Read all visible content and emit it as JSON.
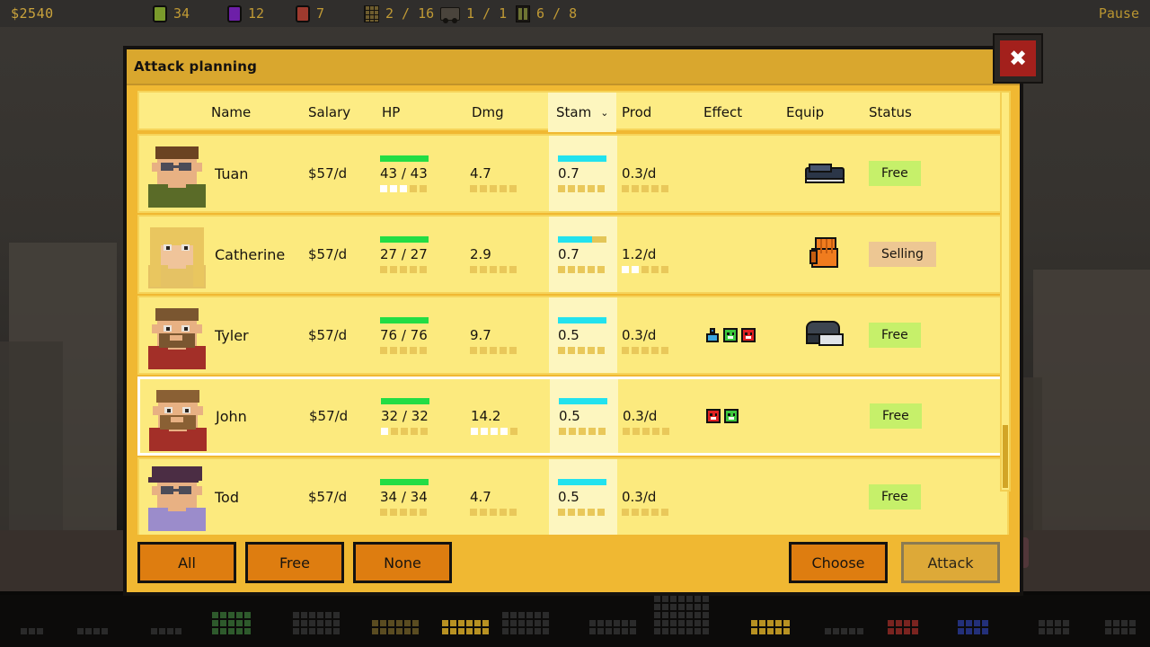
{
  "hud": {
    "money": "$2540",
    "resources": [
      {
        "icon": "green-gem-icon",
        "name": "resource-green",
        "value": "34"
      },
      {
        "icon": "purple-gem-icon",
        "name": "resource-purple",
        "value": "12"
      },
      {
        "icon": "red-gem-icon",
        "name": "resource-red",
        "value": "7"
      }
    ],
    "counters": [
      {
        "icon": "building-icon",
        "name": "buildings-counter",
        "value": "2 / 16"
      },
      {
        "icon": "truck-icon",
        "name": "vehicles-counter",
        "value": "1 / 1"
      },
      {
        "icon": "door-icon",
        "name": "doors-counter",
        "value": "6 / 8"
      }
    ],
    "pause_label": "Pause"
  },
  "dialog": {
    "title": "Attack planning",
    "close_label": "✖",
    "columns": [
      {
        "key": "name",
        "label": "Name"
      },
      {
        "key": "salary",
        "label": "Salary"
      },
      {
        "key": "hp",
        "label": "HP"
      },
      {
        "key": "dmg",
        "label": "Dmg"
      },
      {
        "key": "stam",
        "label": "Stam",
        "sorted": true,
        "sort_indicator": "⌄"
      },
      {
        "key": "prod",
        "label": "Prod"
      },
      {
        "key": "effect",
        "label": "Effect"
      },
      {
        "key": "equip",
        "label": "Equip"
      },
      {
        "key": "status",
        "label": "Status"
      }
    ],
    "rows": [
      {
        "name": "Tuan",
        "salary": "$57/d",
        "hp": "43 / 43",
        "hp_bar": 100,
        "hp_pips": [
          1,
          1,
          1,
          0,
          0
        ],
        "dmg": "4.7",
        "dmg_pips": [
          0,
          0,
          0,
          0,
          0
        ],
        "stam": "0.7",
        "stam_bar": 100,
        "stam_pips": [
          0,
          0,
          0,
          0,
          0
        ],
        "prod": "0.3/d",
        "prod_pips": [
          0,
          0,
          0,
          0,
          0
        ],
        "effects": [],
        "equip": "shoe-icon",
        "status": "Free",
        "status_kind": "free",
        "selected": false,
        "portrait": {
          "skin": "#e8b183",
          "hair": "#6b4322",
          "shirt": "#5a6b28",
          "glasses": true,
          "beard": false,
          "hat": false,
          "long_hair": false
        }
      },
      {
        "name": "Catherine",
        "salary": "$57/d",
        "hp": "27 / 27",
        "hp_bar": 100,
        "hp_pips": [
          0,
          0,
          0,
          0,
          0
        ],
        "dmg": "2.9",
        "dmg_pips": [
          0,
          0,
          0,
          0,
          0
        ],
        "stam": "0.7",
        "stam_bar": 70,
        "stam_pips": [
          0,
          0,
          0,
          0,
          0
        ],
        "prod": "1.2/d",
        "prod_pips": [
          1,
          1,
          0,
          0,
          0
        ],
        "effects": [],
        "equip": "glove-icon",
        "status": "Selling",
        "status_kind": "selling",
        "selected": false,
        "portrait": {
          "skin": "#f0c49a",
          "hair": "#e9c65f",
          "shirt": "#e5c264",
          "glasses": false,
          "beard": false,
          "hat": false,
          "long_hair": true
        }
      },
      {
        "name": "Tyler",
        "salary": "$57/d",
        "hp": "76 / 76",
        "hp_bar": 100,
        "hp_pips": [
          0,
          0,
          0,
          0,
          0
        ],
        "dmg": "9.7",
        "dmg_pips": [
          0,
          0,
          0,
          0,
          0
        ],
        "stam": "0.5",
        "stam_bar": 100,
        "stam_pips": [
          0,
          0,
          0,
          0,
          0
        ],
        "prod": "0.3/d",
        "prod_pips": [
          0,
          0,
          0,
          0,
          0
        ],
        "effects": [
          "flask-icon",
          "happy-face-icon",
          "angry-face-icon"
        ],
        "equip": "helmet-icon",
        "status": "Free",
        "status_kind": "free",
        "selected": false,
        "portrait": {
          "skin": "#e8b183",
          "hair": "#7a5630",
          "shirt": "#a32f28",
          "glasses": false,
          "beard": true,
          "hat": false,
          "long_hair": false
        }
      },
      {
        "name": "John",
        "salary": "$57/d",
        "hp": "32 / 32",
        "hp_bar": 100,
        "hp_pips": [
          1,
          0,
          0,
          0,
          0
        ],
        "dmg": "14.2",
        "dmg_pips": [
          1,
          1,
          1,
          1,
          0
        ],
        "stam": "0.5",
        "stam_bar": 100,
        "stam_pips": [
          0,
          0,
          0,
          0,
          0
        ],
        "prod": "0.3/d",
        "prod_pips": [
          0,
          0,
          0,
          0,
          0
        ],
        "effects": [
          "angry-face-icon",
          "happy-face-icon"
        ],
        "equip": "",
        "status": "Free",
        "status_kind": "free",
        "selected": true,
        "portrait": {
          "skin": "#e8b183",
          "hair": "#8a6034",
          "shirt": "#a32f28",
          "glasses": false,
          "beard": true,
          "hat": false,
          "long_hair": false
        }
      },
      {
        "name": "Tod",
        "salary": "$57/d",
        "hp": "34 / 34",
        "hp_bar": 100,
        "hp_pips": [
          0,
          0,
          0,
          0,
          0
        ],
        "dmg": "4.7",
        "dmg_pips": [
          0,
          0,
          0,
          0,
          0
        ],
        "stam": "0.5",
        "stam_bar": 100,
        "stam_pips": [
          0,
          0,
          0,
          0,
          0
        ],
        "prod": "0.3/d",
        "prod_pips": [
          0,
          0,
          0,
          0,
          0
        ],
        "effects": [],
        "equip": "",
        "status": "Free",
        "status_kind": "free",
        "selected": false,
        "portrait": {
          "skin": "#e8b183",
          "hair": "#4b2d44",
          "shirt": "#9b8ccb",
          "glasses": true,
          "beard": false,
          "hat": true,
          "long_hair": false
        }
      }
    ],
    "footer": {
      "left_buttons": [
        {
          "key": "all",
          "label": "All",
          "disabled": false
        },
        {
          "key": "free",
          "label": "Free",
          "disabled": false
        },
        {
          "key": "none",
          "label": "None",
          "disabled": false
        }
      ],
      "right_buttons": [
        {
          "key": "choose",
          "label": "Choose",
          "disabled": false
        },
        {
          "key": "attack",
          "label": "Attack",
          "disabled": true
        }
      ]
    }
  }
}
